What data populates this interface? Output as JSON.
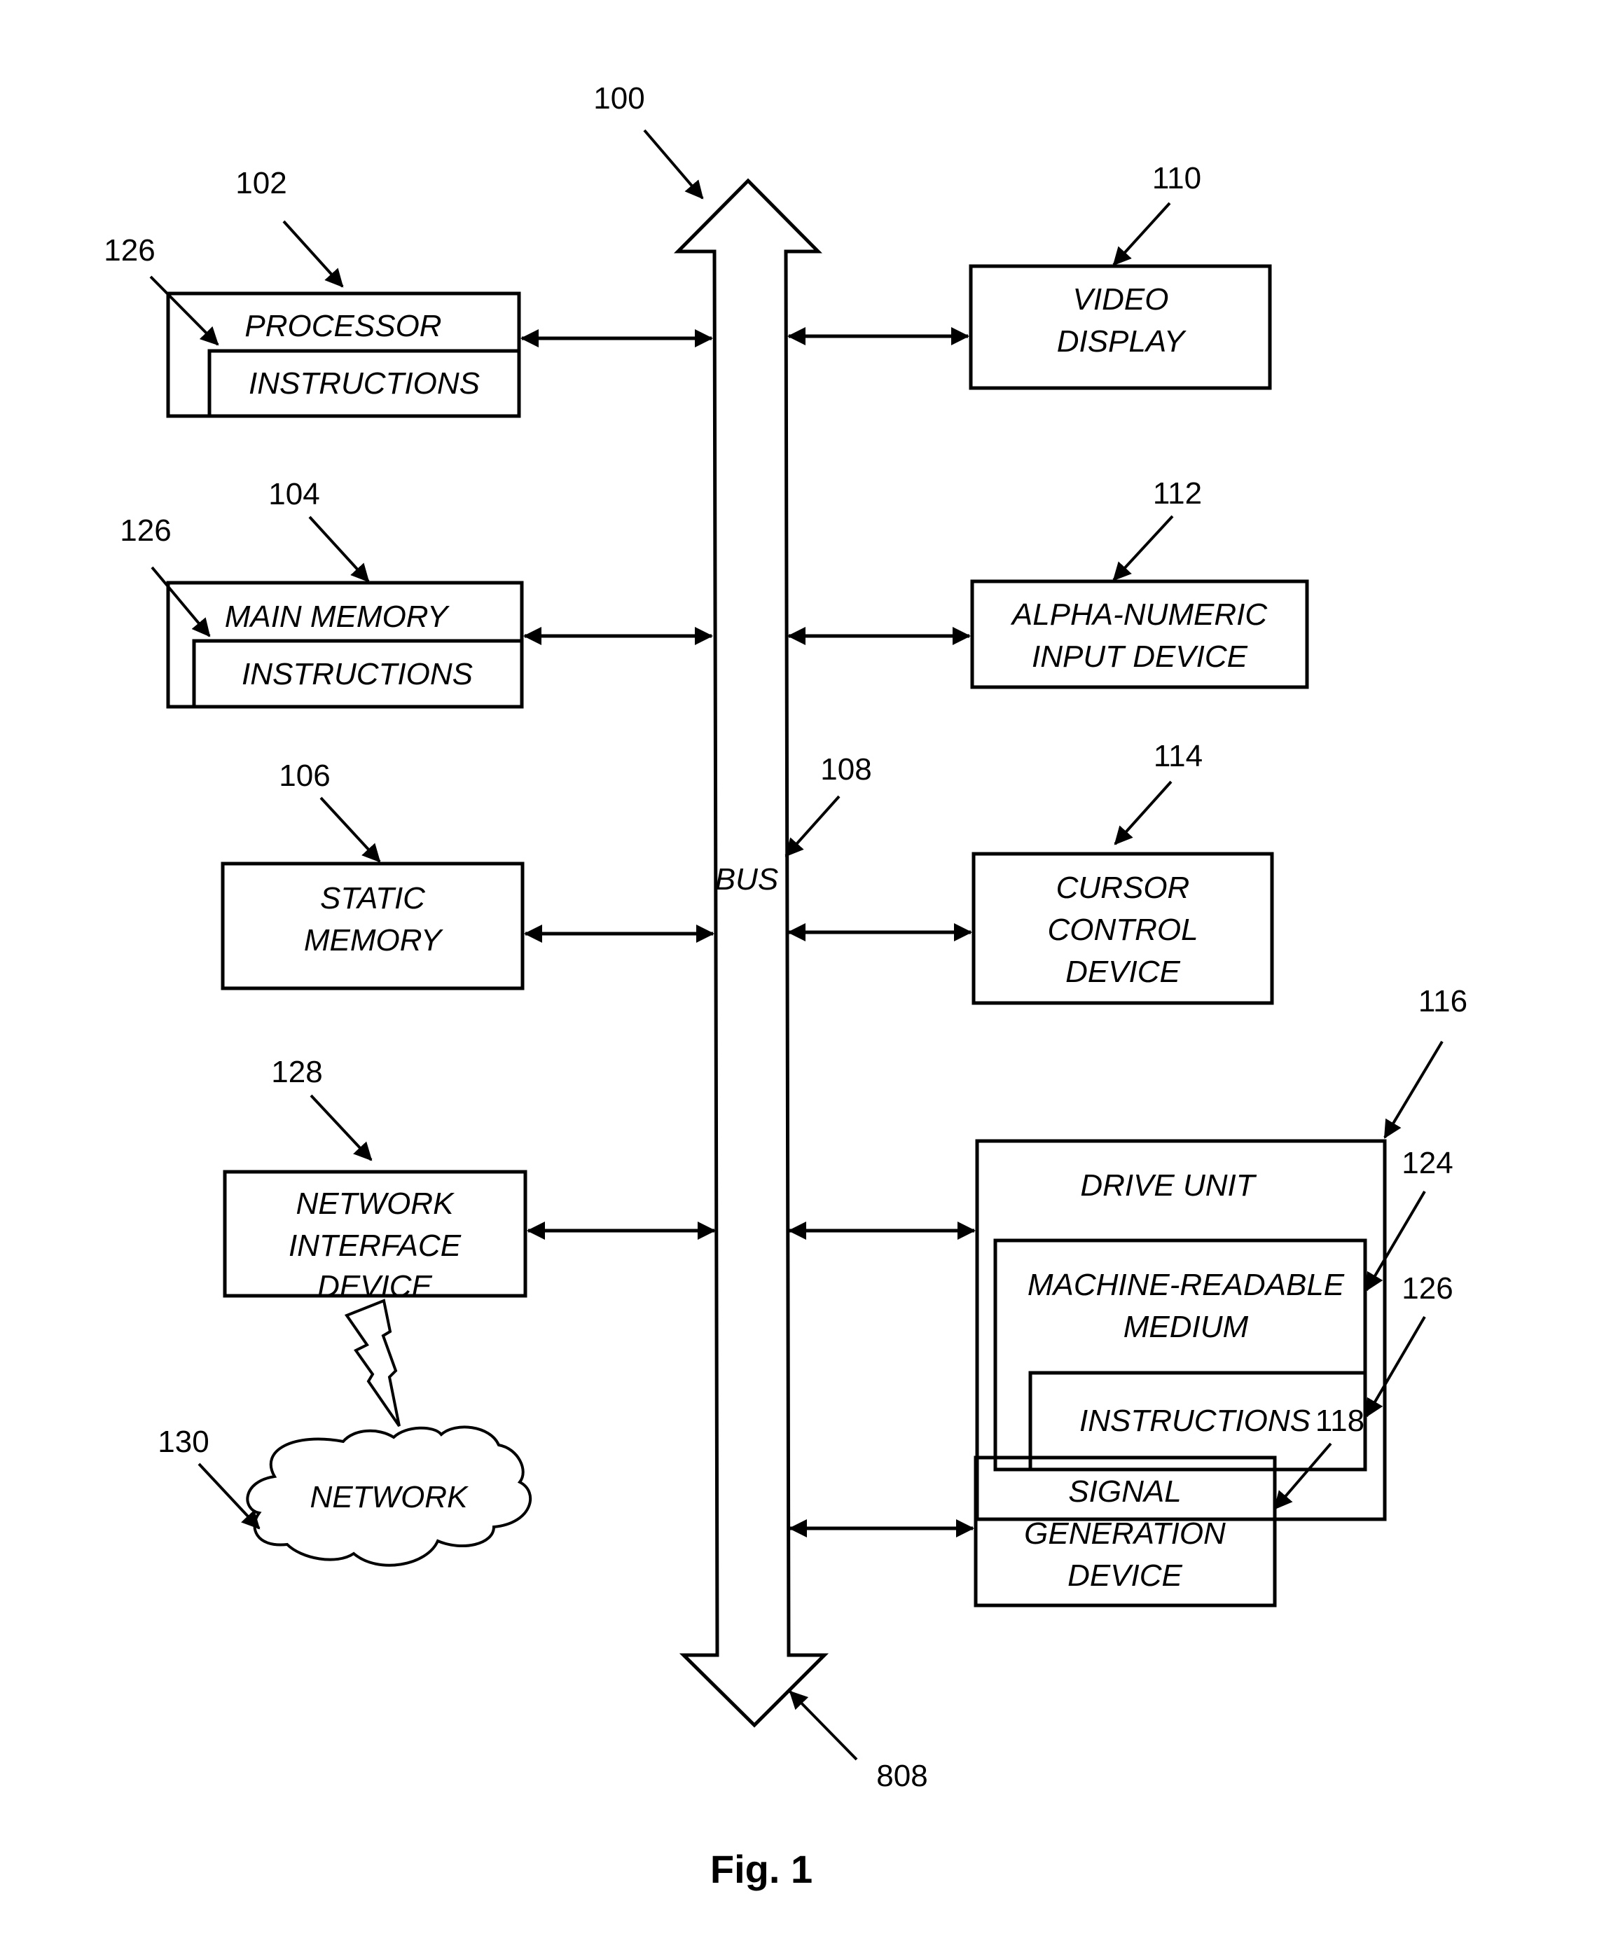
{
  "figure": {
    "caption": "Fig. 1",
    "system_ref": "100",
    "bus": {
      "label": "BUS",
      "ref": "108",
      "ref_bottom": "808"
    }
  },
  "blocks": {
    "processor": {
      "ref": "102",
      "label": "PROCESSOR",
      "inner_label": "INSTRUCTIONS",
      "inner_ref": "126"
    },
    "main_memory": {
      "ref": "104",
      "label": "MAIN MEMORY",
      "inner_label": "INSTRUCTIONS",
      "inner_ref": "126"
    },
    "static_memory": {
      "ref": "106",
      "lines": [
        "STATIC",
        "MEMORY"
      ]
    },
    "network_interface": {
      "ref": "128",
      "lines": [
        "NETWORK",
        "INTERFACE",
        "DEVICE"
      ]
    },
    "network": {
      "ref": "130",
      "label": "NETWORK"
    },
    "video_display": {
      "ref": "110",
      "lines": [
        "VIDEO",
        "DISPLAY"
      ]
    },
    "alpha_input": {
      "ref": "112",
      "lines": [
        "ALPHA-NUMERIC",
        "INPUT DEVICE"
      ]
    },
    "cursor_control": {
      "ref": "114",
      "lines": [
        "CURSOR",
        "CONTROL",
        "DEVICE"
      ]
    },
    "drive_unit": {
      "ref": "116",
      "label": "DRIVE UNIT",
      "medium_ref": "124",
      "medium_lines": [
        "MACHINE-READABLE",
        "MEDIUM"
      ],
      "inner_label": "INSTRUCTIONS",
      "inner_ref": "126"
    },
    "signal_generation": {
      "ref": "118",
      "lines": [
        "SIGNAL",
        "GENERATION",
        "DEVICE"
      ]
    }
  }
}
